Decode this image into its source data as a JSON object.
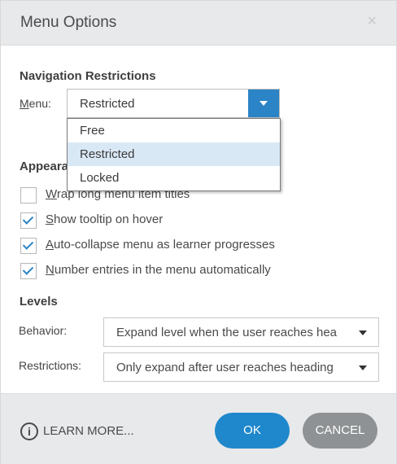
{
  "dialog": {
    "title": "Menu Options",
    "close_glyph": "×"
  },
  "navigation": {
    "heading": "Navigation Restrictions",
    "menu_label_underlined": "M",
    "menu_label_rest": "enu:",
    "menu_selected": "Restricted",
    "options": [
      "Free",
      "Restricted",
      "Locked"
    ],
    "highlighted_option": "Restricted"
  },
  "appearance": {
    "heading_partial": "Appeara",
    "checkboxes": [
      {
        "underlined": "W",
        "rest": "rap long menu item titles",
        "checked": false
      },
      {
        "underlined": "S",
        "rest": "how tooltip on hover",
        "checked": true
      },
      {
        "underlined": "A",
        "rest": "uto-collapse menu as learner progresses",
        "checked": true
      },
      {
        "underlined": "N",
        "rest": "umber entries in the menu automatically",
        "checked": true
      }
    ]
  },
  "levels": {
    "heading": "Levels",
    "behavior_label": "Behavior:",
    "behavior_value": "Expand level when the user reaches hea",
    "restrictions_label": "Restrictions:",
    "restrictions_value": "Only expand after user reaches heading"
  },
  "footer": {
    "info_glyph": "i",
    "learn_more": "LEARN MORE...",
    "ok_label": "OK",
    "cancel_label": "CANCEL"
  },
  "colors": {
    "accent": "#2b84c6",
    "ok_button": "#1f88cc",
    "cancel_button": "#8f9294",
    "highlight": "#d9e8f5",
    "titlebar": "#e8e9eb"
  }
}
